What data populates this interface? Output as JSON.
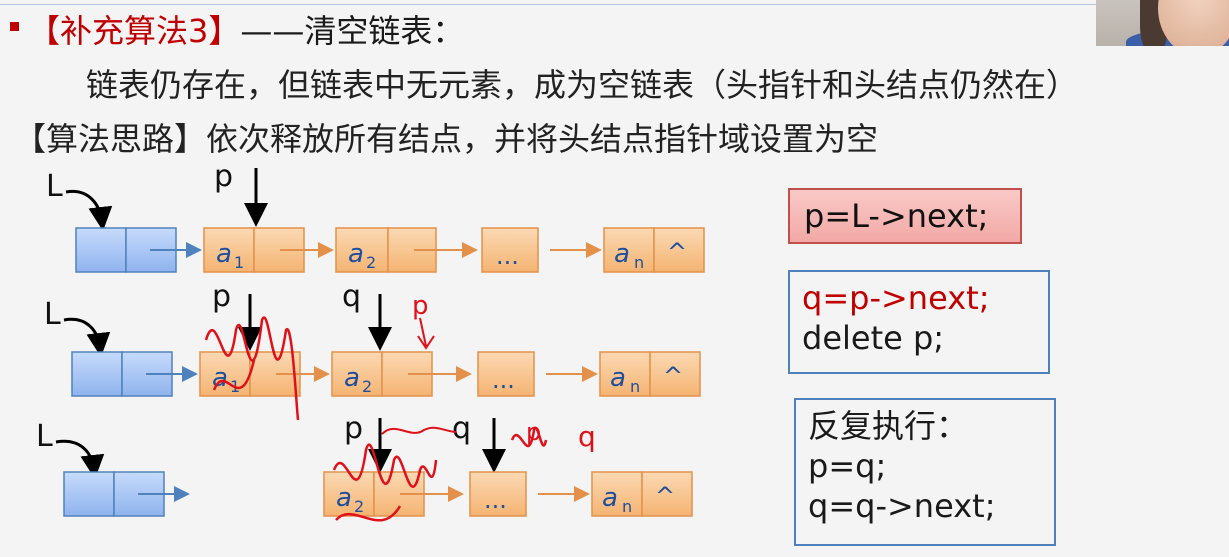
{
  "slide": {
    "title_red": "【补充算法3】",
    "title_rest": "——清空链表：",
    "description": "链表仍存在，但链表中无元素，成为空链表（头指针和头结点仍然在）",
    "idea": "【算法思路】依次释放所有结点，并将头结点指针域设置为空"
  },
  "diagram": {
    "head_label": "L",
    "pointer_p": "p",
    "pointer_q": "q",
    "node_a": "a",
    "sub_1": "1",
    "sub_2": "2",
    "sub_n": "n",
    "ellipsis": "...",
    "null_symbol": "^",
    "handwritten_p": "p",
    "handwritten_q": "q"
  },
  "code": {
    "step1": "p=L->next;",
    "step2_line1": "q=p->next;",
    "step2_line2": "delete p;",
    "step3_line1": "反复执行：",
    "step3_line2": "p=q;",
    "step3_line3": "q=q->next;"
  },
  "colors": {
    "accent_red": "#c00000",
    "head_node_blue": "#9cbdf0",
    "data_node_orange": "#f7c38d",
    "box_border_blue": "#4f81bd",
    "ink_red": "#e0101a"
  }
}
